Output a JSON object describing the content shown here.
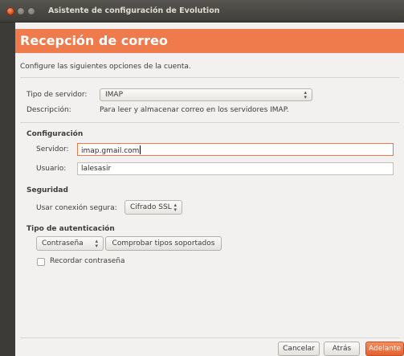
{
  "window": {
    "title": "Asistente de configuración de Evolution"
  },
  "header": {
    "title": "Recepción de correo"
  },
  "intro": "Configure las siguientes opciones de la cuenta.",
  "server_type": {
    "label": "Tipo de servidor:",
    "value": "IMAP"
  },
  "description": {
    "label": "Descripción:",
    "value": "Para leer y almacenar correo en los servidores IMAP."
  },
  "configuration": {
    "heading": "Configuración",
    "server_label": "Servidor:",
    "server_value": "imap.gmail.com",
    "user_label": "Usuario:",
    "user_value": "lalesasir"
  },
  "security": {
    "heading": "Seguridad",
    "label": "Usar conexión segura:",
    "value": "Cifrado SSL"
  },
  "authentication": {
    "heading": "Tipo de autenticación",
    "type_value": "Contraseña",
    "check_button": "Comprobar tipos soportados",
    "remember_label": "Recordar contraseña"
  },
  "footer": {
    "cancel": "Cancelar",
    "back": "Atrás",
    "forward": "Adelante"
  },
  "colors": {
    "accent": "#ef7a4c",
    "focus": "#f07746"
  }
}
